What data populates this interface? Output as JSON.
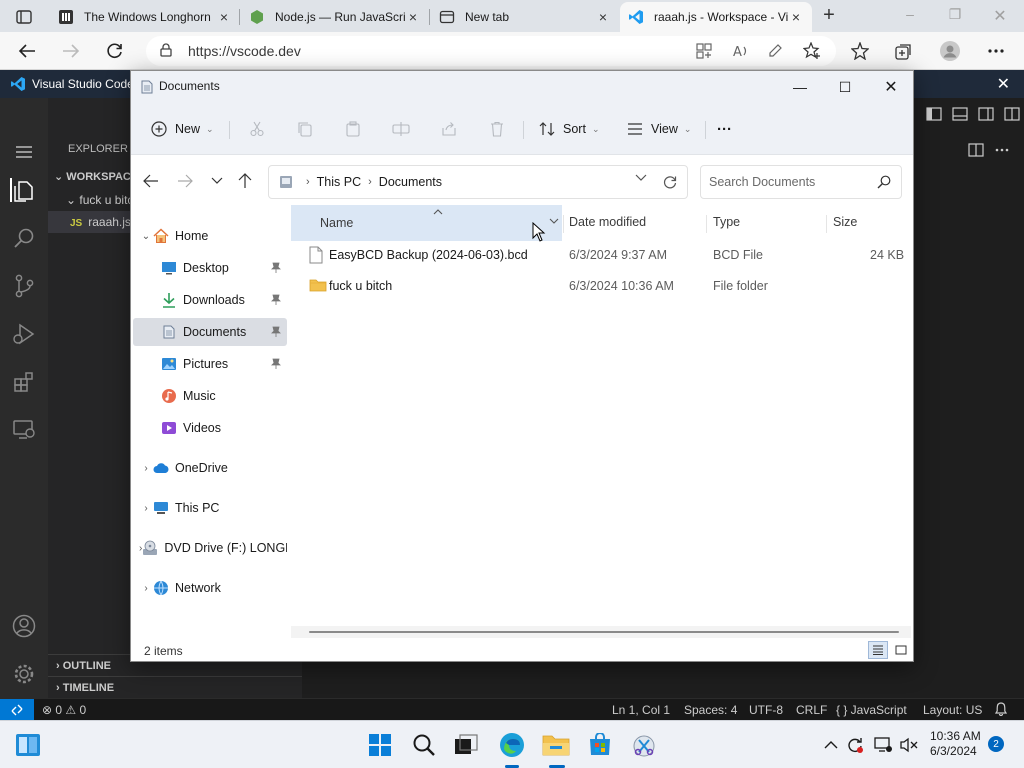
{
  "browser": {
    "tabs": [
      {
        "title": "The Windows Longhorn",
        "close": "×"
      },
      {
        "title": "Node.js — Run JavaScript",
        "close": "×"
      },
      {
        "title": "New tab",
        "close": "×"
      },
      {
        "title": "raaah.js - Workspace - Visual Studio Code",
        "close": "×"
      }
    ],
    "new_tab": "+",
    "minimize": "–",
    "maximize": "❐",
    "close": "✕",
    "url": "https://vscode.dev"
  },
  "vscode": {
    "title": "Visual Studio Code",
    "close": "✕",
    "sidebar": {
      "header": "EXPLORER",
      "workspace": "WORKSPACE",
      "folder": "fuck u bitch",
      "file_badge": "JS",
      "file": "raaah.js",
      "outline": "OUTLINE",
      "timeline": "TIMELINE"
    },
    "status": {
      "problems": "⊗ 0 ⚠ 0",
      "position": "Ln 1, Col 1",
      "spaces": "Spaces: 4",
      "encoding": "UTF-8",
      "eol": "CRLF",
      "language": "{ } JavaScript",
      "layout": "Layout: US"
    }
  },
  "explorer": {
    "title": "Documents",
    "minimize": "—",
    "maximize": "☐",
    "close": "✕",
    "commands": {
      "new": "New",
      "sort": "Sort",
      "view": "View",
      "more": "···"
    },
    "breadcrumb": [
      "This PC",
      "Documents"
    ],
    "search_placeholder": "Search Documents",
    "nav": [
      {
        "label": "Home",
        "expanded": true
      },
      {
        "label": "Desktop",
        "pinned": true
      },
      {
        "label": "Downloads",
        "pinned": true
      },
      {
        "label": "Documents",
        "pinned": true,
        "selected": true
      },
      {
        "label": "Pictures",
        "pinned": true
      },
      {
        "label": "Music"
      },
      {
        "label": "Videos"
      },
      {
        "label": "OneDrive"
      },
      {
        "label": "This PC"
      },
      {
        "label": "DVD Drive (F:) LONGHORN"
      },
      {
        "label": "Network"
      }
    ],
    "columns": {
      "name": "Name",
      "date": "Date modified",
      "type": "Type",
      "size": "Size"
    },
    "files": [
      {
        "name": "EasyBCD Backup (2024-06-03).bcd",
        "date": "6/3/2024 9:37 AM",
        "type": "BCD File",
        "size": "24 KB",
        "icon": "file-icon"
      },
      {
        "name": "fuck u bitch",
        "date": "6/3/2024 10:36 AM",
        "type": "File folder",
        "size": "",
        "icon": "folder-icon"
      }
    ],
    "status": "2 items"
  },
  "taskbar": {
    "time": "10:36 AM",
    "date": "6/3/2024",
    "notifications": "2"
  },
  "colors": {
    "accent": "#0067c0",
    "vscode_status_remote": "#0078d4",
    "folder": "#f2c14e"
  }
}
